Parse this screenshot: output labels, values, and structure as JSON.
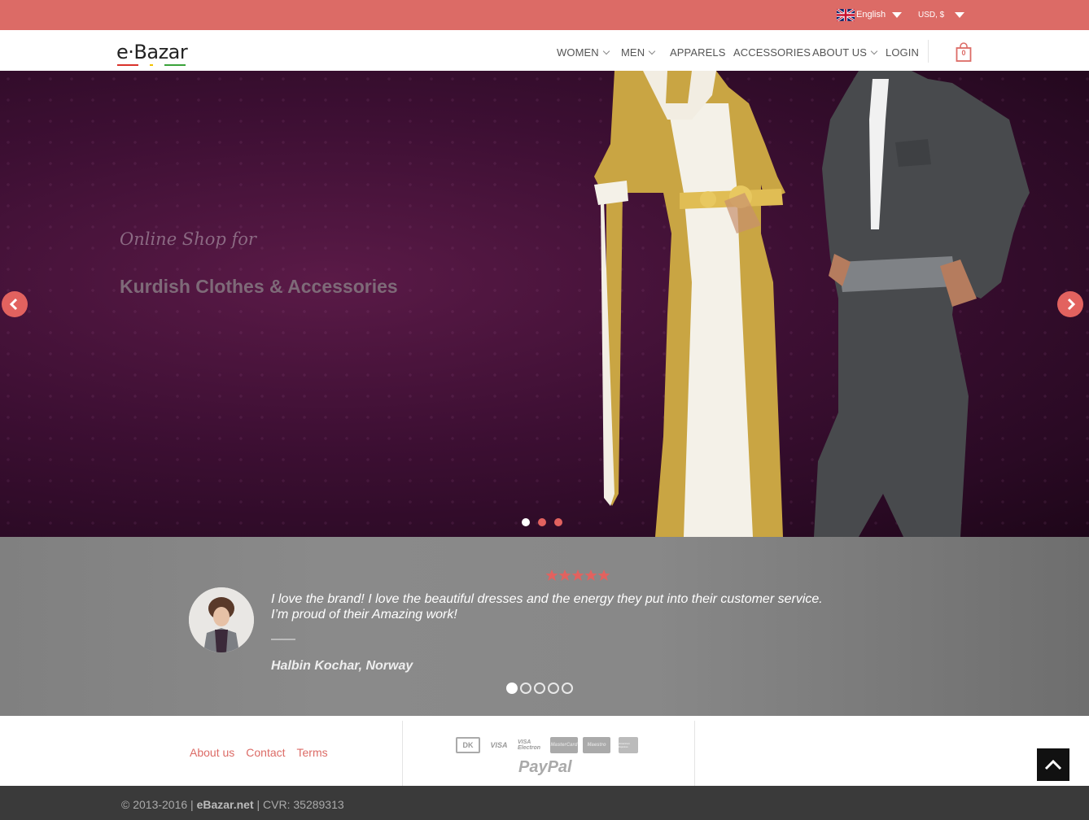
{
  "topbar": {
    "language": "English",
    "currency": "USD, $",
    "flag_icon": "uk-flag-icon",
    "background": "#dc6b66"
  },
  "header": {
    "logo_text": "e·Bazar",
    "nav": [
      {
        "label": "WOMEN",
        "dropdown": true
      },
      {
        "label": "MEN",
        "dropdown": true
      },
      {
        "label": "APPARELS",
        "dropdown": false
      },
      {
        "label": "ACCESSORIES",
        "dropdown": false
      },
      {
        "label": "ABOUT US",
        "dropdown": true
      },
      {
        "label": "LOGIN",
        "dropdown": false
      }
    ],
    "cart_count": "0"
  },
  "hero": {
    "subtitle": "Online Shop for",
    "title": "Kurdish Clothes & Accessories",
    "slides": 3,
    "active_slide": 1,
    "prev_icon": "chevron-left-icon",
    "next_icon": "chevron-right-icon",
    "accent": "#e2625f"
  },
  "testimonial": {
    "rating": 5,
    "quote": "I love the brand! I love the beautiful dresses and the energy they put into their customer service. I’m proud of their Amazing work!",
    "author": "Halbin Kochar,  Norway",
    "pages": 5,
    "active_page": 1
  },
  "footer": {
    "links": [
      "About us",
      "Contact",
      "Terms"
    ],
    "payment_methods": [
      "DK",
      "VISA",
      "VISA Electron",
      "MasterCard",
      "Maestro",
      "American Express"
    ],
    "paypal": "PayPal",
    "copyright_prefix": "© 2013-2016 |",
    "copyright_site": "eBazar.net",
    "copyright_suffix": "| CVR: 35289313"
  }
}
